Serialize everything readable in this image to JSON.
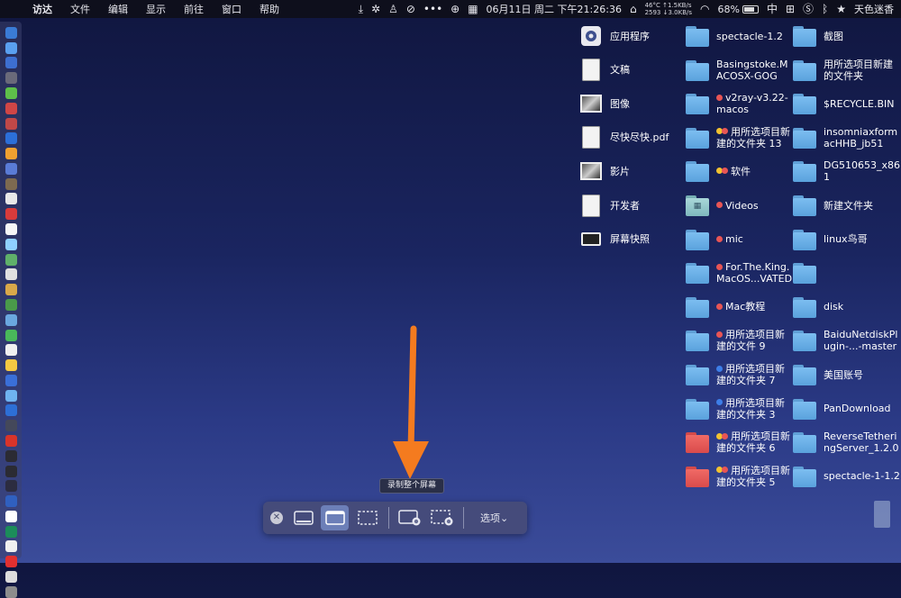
{
  "menubar": {
    "apple_glyph": "",
    "app_name": "访达",
    "items": [
      "文件",
      "编辑",
      "显示",
      "前往",
      "窗口",
      "帮助"
    ],
    "stats_line1": "46°C ↑1.5KB/s",
    "stats_line2": "2593 ↓3.0KB/s",
    "clock": "06月11日 周二 下午21:26:36",
    "battery": "68%",
    "input_method": "中",
    "user": "天色迷香"
  },
  "dock_colors": [
    "#3a7bd5",
    "#5aa0f0",
    "#3d6fd0",
    "#6a6a7a",
    "#5ec04a",
    "#d04646",
    "#c04848",
    "#2c6fd8",
    "#f0a030",
    "#5a7bd6",
    "#7d6a50",
    "#e8e8e8",
    "#d93b3b",
    "#f6f6f6",
    "#8fd0ff",
    "#5fb06a",
    "#e0e0e0",
    "#d9a84a",
    "#4a9a4a",
    "#6aa7e0",
    "#49b85a",
    "#f0f0f0",
    "#f5c842",
    "#3a6fd8",
    "#6fb3f0",
    "#2d6fd6",
    "#44485a",
    "#d8342a",
    "#2b2b33",
    "#2b2b33",
    "#2c2c40",
    "#3060c0",
    "#ffffff",
    "#1c8c5a",
    "#f0f0f0",
    "#e23030",
    "#dcdcdc",
    "#8d8d8d"
  ],
  "desktop": {
    "col1": [
      {
        "label": "应用程序",
        "icon": "applications-icon"
      },
      {
        "label": "文稿",
        "icon": "documents-icon"
      },
      {
        "label": "图像",
        "icon": "images-icon"
      },
      {
        "label": "尽快尽快.pdf",
        "icon": "pdf-icon"
      },
      {
        "label": "影片",
        "icon": "movies-icon"
      },
      {
        "label": "开发者",
        "icon": "developer-icon"
      },
      {
        "label": "屏幕快照",
        "icon": "screenshot-icon"
      }
    ],
    "col2": [
      {
        "label": "spectacle-1.2",
        "folder": "blue",
        "tags": []
      },
      {
        "label": "Basingstoke.M\nACOSX-GOG",
        "folder": "blue",
        "tags": []
      },
      {
        "label": "v2ray-v3.22-\nmacos",
        "folder": "blue",
        "tags": [
          "#e85555"
        ]
      },
      {
        "label": "用所选项目新\n建的文件夹 13",
        "folder": "blue",
        "tags": [
          "#f2c230",
          "#e85555"
        ]
      },
      {
        "label": "软件",
        "folder": "blue",
        "tags": [
          "#f2c230",
          "#e85555"
        ]
      },
      {
        "label": "Videos",
        "folder": "teal",
        "tags": [
          "#e85555"
        ]
      },
      {
        "label": "mic",
        "folder": "blue",
        "tags": [
          "#e85555"
        ]
      },
      {
        "label": "For.The.King.\nMacOS...VATED",
        "folder": "blue",
        "tags": [
          "#e85555"
        ]
      },
      {
        "label": "Mac教程",
        "folder": "blue",
        "tags": [
          "#e85555"
        ]
      },
      {
        "label": "用所选项目新\n建的文件 9",
        "folder": "blue",
        "tags": [
          "#e85555"
        ]
      },
      {
        "label": "用所选项目新\n建的文件夹 7",
        "folder": "blue",
        "tags": [
          "#3d7ee8"
        ]
      },
      {
        "label": "用所选项目新\n建的文件夹 3",
        "folder": "blue",
        "tags": [
          "#3d7ee8"
        ]
      },
      {
        "label": "用所选项目新\n建的文件夹 6",
        "folder": "red",
        "tags": [
          "#f2c230",
          "#e85555"
        ]
      },
      {
        "label": "用所选项目新\n建的文件夹 5",
        "folder": "red",
        "tags": [
          "#f2c230",
          "#e85555"
        ]
      }
    ],
    "col3": [
      {
        "label": "截图",
        "folder": "blue"
      },
      {
        "label": "用所选项目新建\n的文件夹",
        "folder": "blue"
      },
      {
        "label": "$RECYCLE.BIN",
        "folder": "blue"
      },
      {
        "label": "insomniaxform\nacHHB_jb51",
        "folder": "blue"
      },
      {
        "label": "DG510653_x86\n1",
        "folder": "blue"
      },
      {
        "label": "新建文件夹",
        "folder": "blue"
      },
      {
        "label": "linux鸟哥",
        "folder": "blue"
      },
      {
        "label": "",
        "folder": "blue"
      },
      {
        "label": "disk",
        "folder": "blue"
      },
      {
        "label": "BaiduNetdiskPl\nugin-...-master",
        "folder": "blue"
      },
      {
        "label": "美国账号",
        "folder": "blue"
      },
      {
        "label": "PanDownload",
        "folder": "blue"
      },
      {
        "label": "ReverseTetheri\nngServer_1.2.0",
        "folder": "blue"
      },
      {
        "label": "spectacle-1-1.2",
        "folder": "blue"
      }
    ]
  },
  "tooltip": "录制整个屏幕",
  "toolbar": {
    "close_glyph": "✕",
    "options_label": "选项",
    "options_chevron": "⌄"
  },
  "colors": {
    "arrow": "#f47b1f",
    "selected_button": "#6c7fb8"
  }
}
